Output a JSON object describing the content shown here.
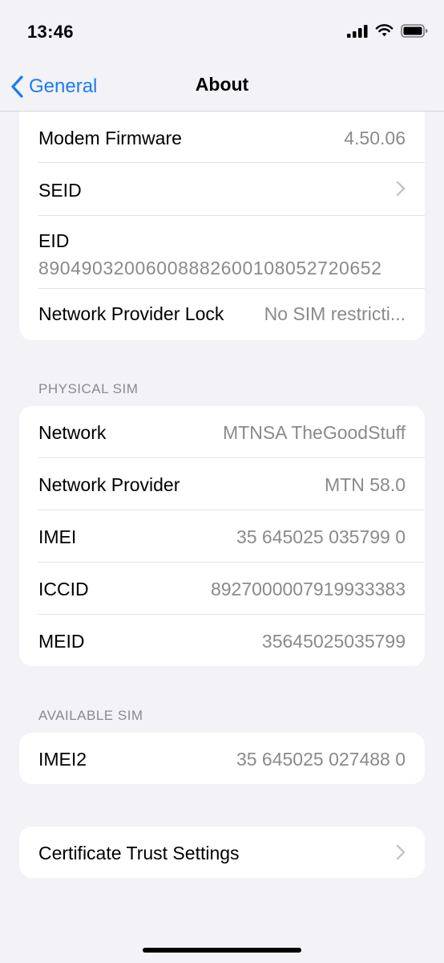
{
  "status": {
    "time": "13:46"
  },
  "nav": {
    "back_label": "General",
    "title": "About"
  },
  "group_top": {
    "modem_firmware": {
      "label": "Modem Firmware",
      "value": "4.50.06"
    },
    "seid": {
      "label": "SEID"
    },
    "eid": {
      "label": "EID",
      "value": "89049032006008882600108052720652"
    },
    "network_provider_lock": {
      "label": "Network Provider Lock",
      "value": "No SIM restricti..."
    }
  },
  "physical_sim": {
    "header": "PHYSICAL SIM",
    "network": {
      "label": "Network",
      "value": "MTNSA TheGoodStuff"
    },
    "network_provider": {
      "label": "Network Provider",
      "value": "MTN 58.0"
    },
    "imei": {
      "label": "IMEI",
      "value": "35 645025 035799 0"
    },
    "iccid": {
      "label": "ICCID",
      "value": "8927000007919933383"
    },
    "meid": {
      "label": "MEID",
      "value": "35645025035799"
    }
  },
  "available_sim": {
    "header": "AVAILABLE SIM",
    "imei2": {
      "label": "IMEI2",
      "value": "35 645025 027488 0"
    }
  },
  "certificate_trust": {
    "label": "Certificate Trust Settings"
  },
  "colors": {
    "accent": "#1a7cf5",
    "background": "#f2f2f7",
    "secondary_text": "#8a8a8e"
  },
  "icons": [
    "signal-icon",
    "wifi-icon",
    "battery-icon",
    "chevron-left-icon",
    "chevron-right-icon"
  ]
}
